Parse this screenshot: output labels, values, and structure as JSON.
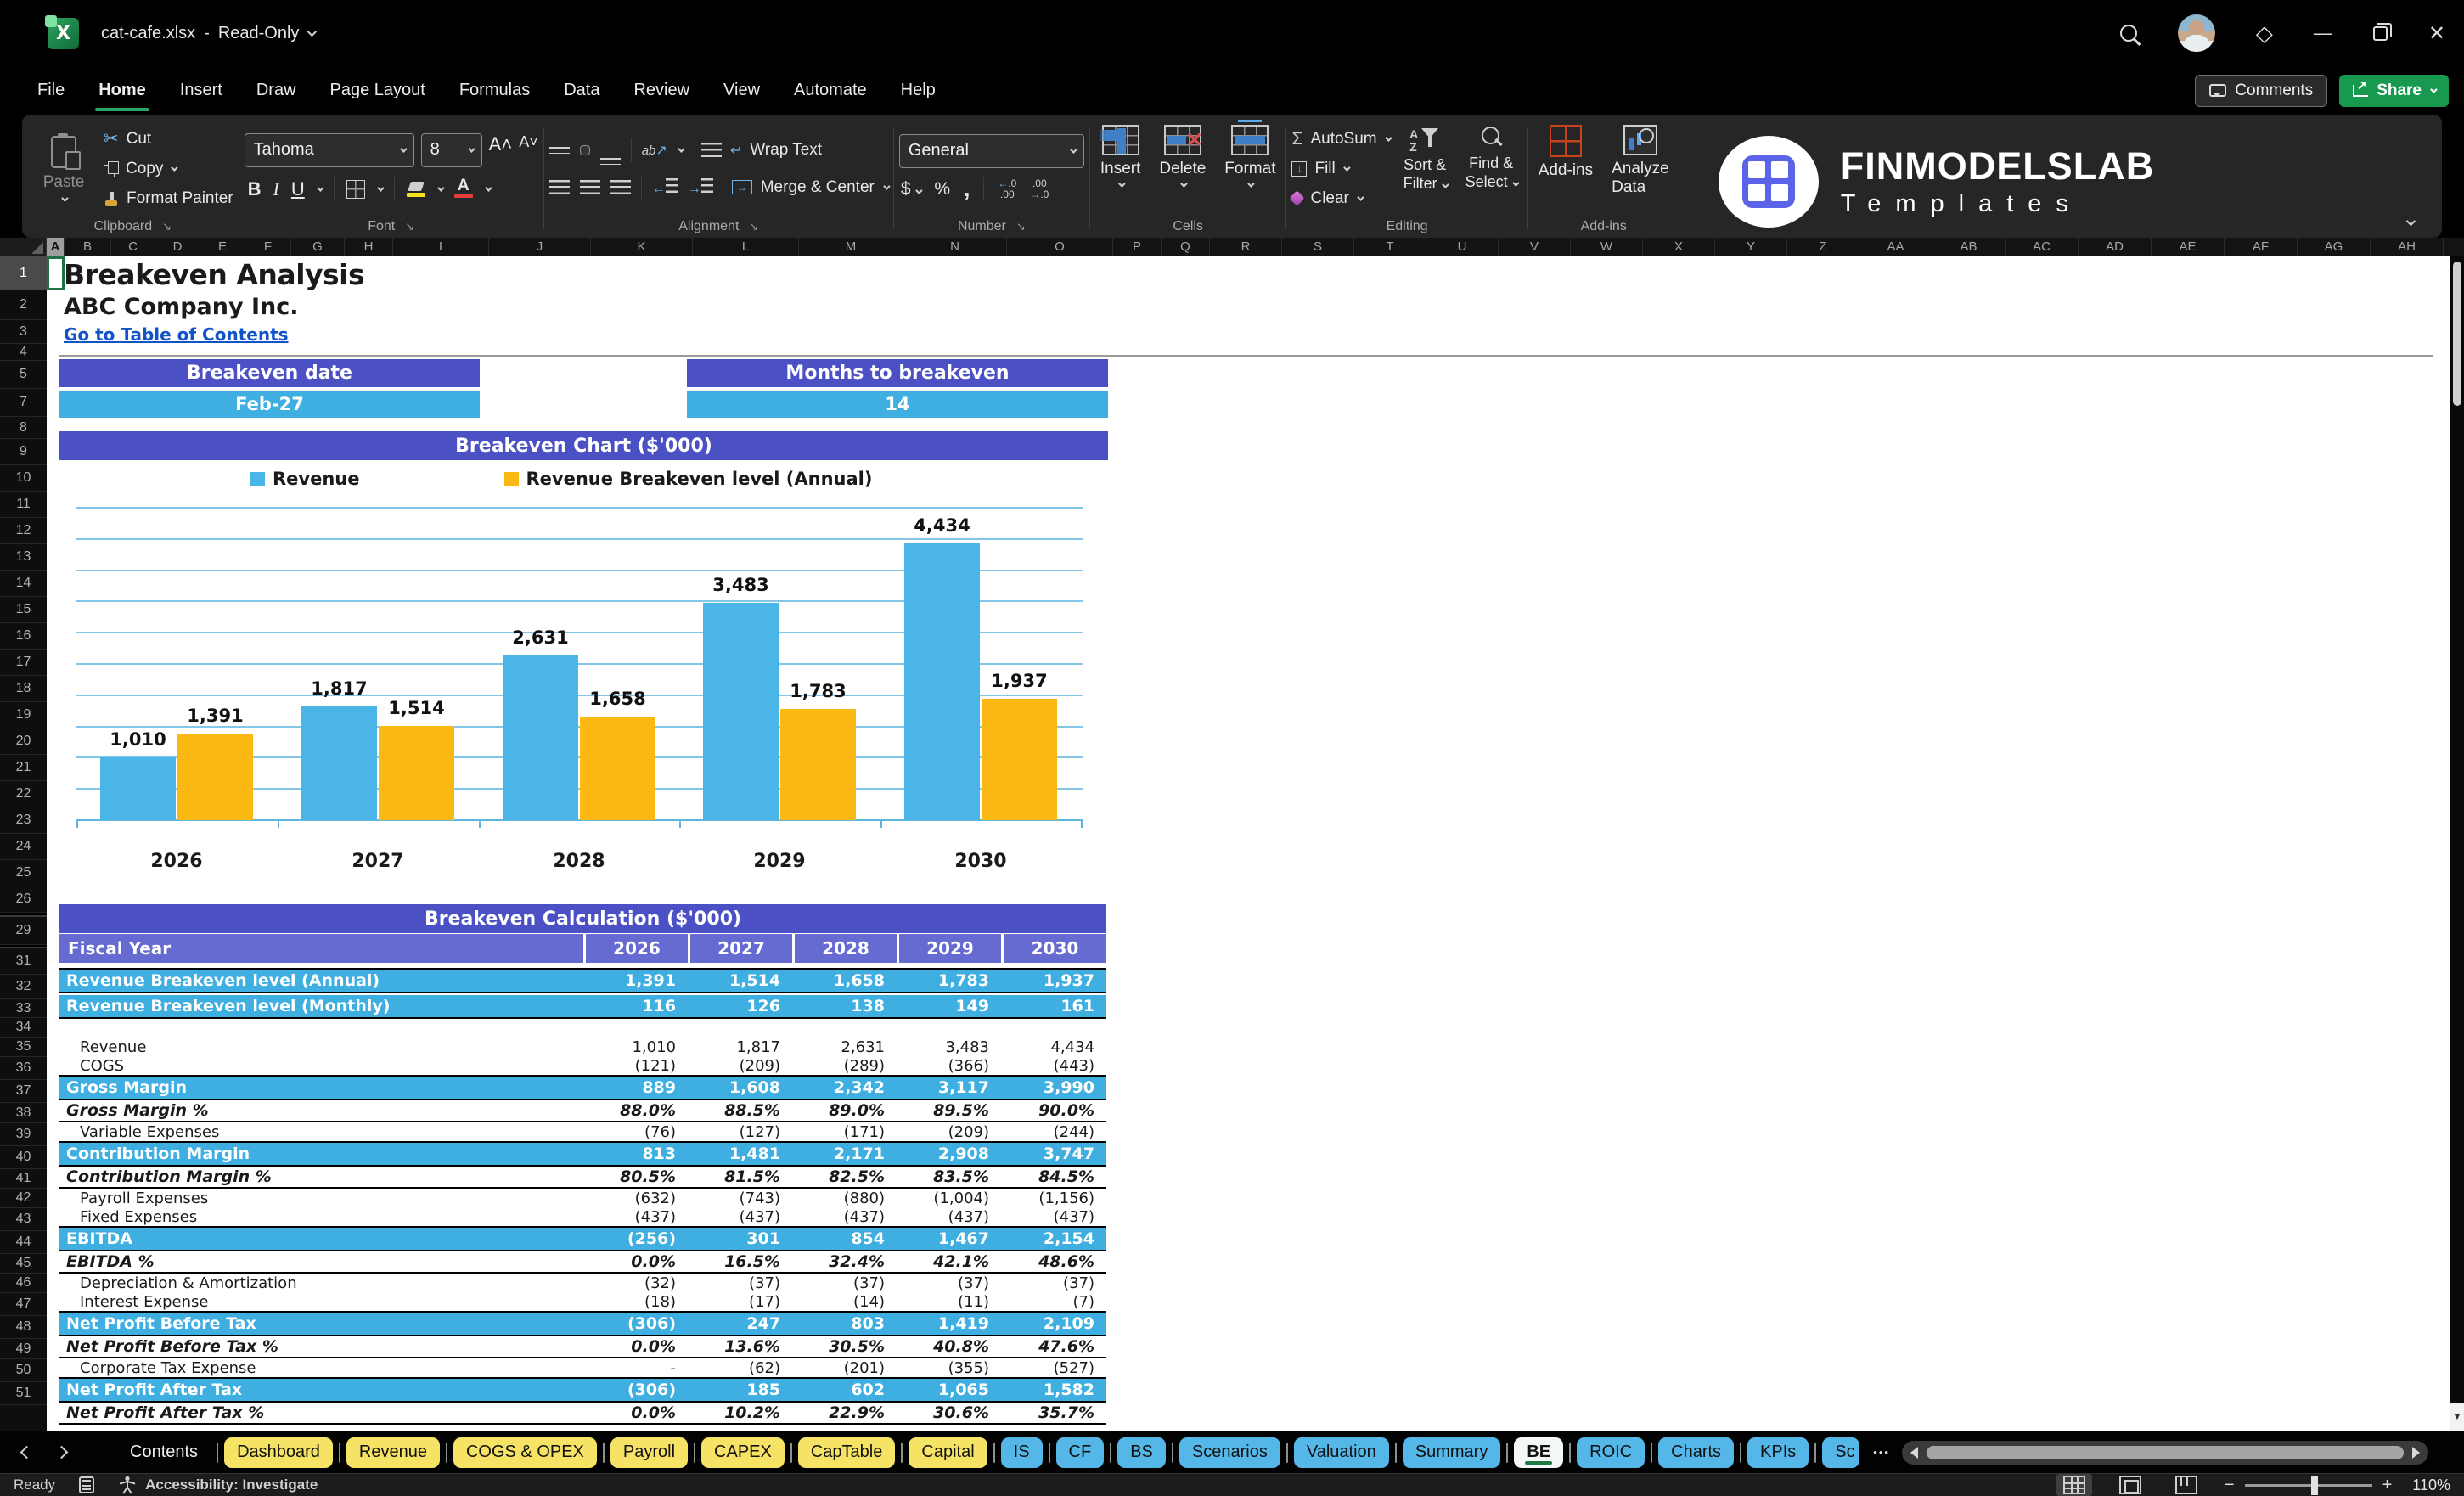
{
  "window": {
    "file_name": "cat-cafe.xlsx",
    "dash": "-",
    "mode": "Read-Only"
  },
  "menu": {
    "tabs": [
      "File",
      "Home",
      "Insert",
      "Draw",
      "Page Layout",
      "Formulas",
      "Data",
      "Review",
      "View",
      "Automate",
      "Help"
    ],
    "active": "Home"
  },
  "actions": {
    "comments": "Comments",
    "share": "Share"
  },
  "ribbon": {
    "clipboard": {
      "paste": "Paste",
      "cut": "Cut",
      "copy": "Copy",
      "format_painter": "Format Painter",
      "label": "Clipboard"
    },
    "font": {
      "family": "Tahoma",
      "size": "8",
      "bold": "B",
      "italic": "I",
      "underline": "U",
      "label": "Font"
    },
    "alignment": {
      "orientation_glyph": "ab",
      "wrap": "Wrap Text",
      "merge": "Merge & Center",
      "label": "Alignment"
    },
    "number": {
      "format": "General",
      "dollar": "$",
      "percent": "%",
      "comma": ",",
      "label": "Number"
    },
    "cells": {
      "insert": "Insert",
      "del": "Delete",
      "format": "Format",
      "label": "Cells"
    },
    "editing": {
      "autosum": "AutoSum",
      "fill": "Fill",
      "clear": "Clear",
      "sort1": "Sort &",
      "sort2": "Filter",
      "find1": "Find &",
      "find2": "Select",
      "label": "Editing"
    },
    "addins": {
      "addins": "Add-ins",
      "analyze1": "Analyze",
      "analyze2": "Data",
      "label": "Add-ins"
    },
    "brand": {
      "name": "FINMODELSLAB",
      "sub": "Templates"
    }
  },
  "sheet": {
    "selected_cell": "A1",
    "columns": [
      {
        "l": "A",
        "w": 21,
        "selected": true
      },
      {
        "l": "B",
        "w": 55
      },
      {
        "l": "C",
        "w": 52
      },
      {
        "l": "D",
        "w": 53
      },
      {
        "l": "E",
        "w": 53
      },
      {
        "l": "F",
        "w": 54
      },
      {
        "l": "G",
        "w": 63
      },
      {
        "l": "H",
        "w": 57
      },
      {
        "l": "I",
        "w": 113
      },
      {
        "l": "J",
        "w": 120
      },
      {
        "l": "K",
        "w": 120
      },
      {
        "l": "L",
        "w": 125
      },
      {
        "l": "M",
        "w": 123
      },
      {
        "l": "N",
        "w": 122
      },
      {
        "l": "O",
        "w": 125
      },
      {
        "l": "P",
        "w": 57
      },
      {
        "l": "Q",
        "w": 57
      },
      {
        "l": "R",
        "w": 85
      },
      {
        "l": "S",
        "w": 85
      },
      {
        "l": "T",
        "w": 85
      },
      {
        "l": "U",
        "w": 85
      },
      {
        "l": "V",
        "w": 85
      },
      {
        "l": "W",
        "w": 85
      },
      {
        "l": "X",
        "w": 85
      },
      {
        "l": "Y",
        "w": 85
      },
      {
        "l": "Z",
        "w": 85
      },
      {
        "l": "AA",
        "w": 86
      },
      {
        "l": "AB",
        "w": 86
      },
      {
        "l": "AC",
        "w": 86
      },
      {
        "l": "AD",
        "w": 86
      },
      {
        "l": "AE",
        "w": 86
      },
      {
        "l": "AF",
        "w": 86
      },
      {
        "l": "AG",
        "w": 86
      },
      {
        "l": "AH",
        "w": 86
      }
    ],
    "rows": [
      {
        "n": "1",
        "h": 40
      },
      {
        "n": "2",
        "h": 35
      },
      {
        "n": "3",
        "h": 28
      },
      {
        "n": "4",
        "h": 20
      },
      {
        "n": "5",
        "h": 33
      },
      {
        "n": "7",
        "h": 33
      },
      {
        "n": "8",
        "h": 26
      },
      {
        "n": "9",
        "h": 31
      },
      {
        "n": "10",
        "h": 31
      },
      {
        "n": "11",
        "h": 31
      },
      {
        "n": "12",
        "h": 31
      },
      {
        "n": "13",
        "h": 31
      },
      {
        "n": "14",
        "h": 31
      },
      {
        "n": "15",
        "h": 31
      },
      {
        "n": "16",
        "h": 31
      },
      {
        "n": "17",
        "h": 31
      },
      {
        "n": "18",
        "h": 31
      },
      {
        "n": "19",
        "h": 31
      },
      {
        "n": "20",
        "h": 31
      },
      {
        "n": "21",
        "h": 31
      },
      {
        "n": "22",
        "h": 31
      },
      {
        "n": "23",
        "h": 31
      },
      {
        "n": "24",
        "h": 31
      },
      {
        "n": "25",
        "h": 31
      },
      {
        "n": "26",
        "h": 31
      },
      {
        "n": "",
        "h": 5
      },
      {
        "n": "29",
        "h": 33
      },
      {
        "n": "",
        "h": 4
      },
      {
        "n": "31",
        "h": 31
      },
      {
        "n": "32",
        "h": 29
      },
      {
        "n": "33",
        "h": 22
      },
      {
        "n": "34",
        "h": 23
      },
      {
        "n": "35",
        "h": 23
      },
      {
        "n": "36",
        "h": 27
      },
      {
        "n": "37",
        "h": 27
      },
      {
        "n": "38",
        "h": 24
      },
      {
        "n": "39",
        "h": 27
      },
      {
        "n": "40",
        "h": 27
      },
      {
        "n": "41",
        "h": 23
      },
      {
        "n": "42",
        "h": 23
      },
      {
        "n": "43",
        "h": 27
      },
      {
        "n": "44",
        "h": 27
      },
      {
        "n": "45",
        "h": 23
      },
      {
        "n": "46",
        "h": 23
      },
      {
        "n": "47",
        "h": 27
      },
      {
        "n": "48",
        "h": 27
      },
      {
        "n": "49",
        "h": 24
      },
      {
        "n": "50",
        "h": 27
      },
      {
        "n": "51",
        "h": 27
      }
    ]
  },
  "content": {
    "title": "Breakeven Analysis",
    "company": "ABC Company Inc.",
    "link": "Go to Table of Contents",
    "date_header": "Breakeven date",
    "date_value": "Feb-27",
    "months_header": "Months to breakeven",
    "months_value": "14",
    "chart_banner": "Breakeven Chart ($'000)",
    "calc_banner": "Breakeven Calculation ($'000)"
  },
  "chart_data": {
    "type": "bar",
    "title": "Breakeven Chart ($'000)",
    "categories": [
      "2026",
      "2027",
      "2028",
      "2029",
      "2030"
    ],
    "series": [
      {
        "name": "Revenue",
        "color": "#4ab5e6",
        "values": [
          1010,
          1817,
          2631,
          3483,
          4434
        ]
      },
      {
        "name": "Revenue Breakeven level (Annual)",
        "color": "#fcb813",
        "values": [
          1391,
          1514,
          1658,
          1783,
          1937
        ]
      }
    ],
    "ylim": [
      0,
      5000
    ],
    "gridline_step": 500,
    "grid": true,
    "legend_position": "top",
    "data_labels": true
  },
  "calc": {
    "fiscal_label": "Fiscal Year",
    "years": [
      "2026",
      "2027",
      "2028",
      "2029",
      "2030"
    ],
    "rows": [
      {
        "label": "Revenue Breakeven level (Annual)",
        "style": "blue",
        "values": [
          "1,391",
          "1,514",
          "1,658",
          "1,783",
          "1,937"
        ]
      },
      {
        "label": "Revenue Breakeven level (Monthly)",
        "style": "blue",
        "values": [
          "116",
          "126",
          "138",
          "149",
          "161"
        ]
      },
      {
        "style": "gap"
      },
      {
        "label": "Revenue",
        "style": "plain",
        "values": [
          "1,010",
          "1,817",
          "2,631",
          "3,483",
          "4,434"
        ]
      },
      {
        "label": "COGS",
        "style": "plain",
        "values": [
          "(121)",
          "(209)",
          "(289)",
          "(366)",
          "(443)"
        ]
      },
      {
        "label": "Gross Margin",
        "style": "blue",
        "values": [
          "889",
          "1,608",
          "2,342",
          "3,117",
          "3,990"
        ]
      },
      {
        "label": "Gross Margin %",
        "style": "pct",
        "values": [
          "88.0%",
          "88.5%",
          "89.0%",
          "89.5%",
          "90.0%"
        ]
      },
      {
        "label": "Variable Expenses",
        "style": "plain",
        "values": [
          "(76)",
          "(127)",
          "(171)",
          "(209)",
          "(244)"
        ]
      },
      {
        "label": "Contribution Margin",
        "style": "blue",
        "values": [
          "813",
          "1,481",
          "2,171",
          "2,908",
          "3,747"
        ]
      },
      {
        "label": "Contribution Margin %",
        "style": "pct",
        "values": [
          "80.5%",
          "81.5%",
          "82.5%",
          "83.5%",
          "84.5%"
        ]
      },
      {
        "label": "Payroll Expenses",
        "style": "plain",
        "values": [
          "(632)",
          "(743)",
          "(880)",
          "(1,004)",
          "(1,156)"
        ]
      },
      {
        "label": "Fixed Expenses",
        "style": "plain",
        "values": [
          "(437)",
          "(437)",
          "(437)",
          "(437)",
          "(437)"
        ]
      },
      {
        "label": "EBITDA",
        "style": "blue",
        "values": [
          "(256)",
          "301",
          "854",
          "1,467",
          "2,154"
        ]
      },
      {
        "label": "EBITDA %",
        "style": "pct",
        "values": [
          "0.0%",
          "16.5%",
          "32.4%",
          "42.1%",
          "48.6%"
        ]
      },
      {
        "label": "Depreciation & Amortization",
        "style": "plain",
        "values": [
          "(32)",
          "(37)",
          "(37)",
          "(37)",
          "(37)"
        ]
      },
      {
        "label": "Interest Expense",
        "style": "plain",
        "values": [
          "(18)",
          "(17)",
          "(14)",
          "(11)",
          "(7)"
        ]
      },
      {
        "label": "Net Profit Before Tax",
        "style": "blue",
        "values": [
          "(306)",
          "247",
          "803",
          "1,419",
          "2,109"
        ]
      },
      {
        "label": "Net Profit Before Tax %",
        "style": "pct",
        "values": [
          "0.0%",
          "13.6%",
          "30.5%",
          "40.8%",
          "47.6%"
        ]
      },
      {
        "label": "Corporate Tax Expense",
        "style": "plain",
        "values": [
          "-",
          "(62)",
          "(201)",
          "(355)",
          "(527)"
        ]
      },
      {
        "label": "Net Profit After Tax",
        "style": "blue",
        "values": [
          "(306)",
          "185",
          "602",
          "1,065",
          "1,582"
        ]
      },
      {
        "label": "Net Profit After Tax %",
        "style": "pct",
        "values": [
          "0.0%",
          "10.2%",
          "22.9%",
          "30.6%",
          "35.7%"
        ]
      }
    ]
  },
  "sheet_tabs": [
    {
      "label": "Contents",
      "style": "plain"
    },
    {
      "label": "Dashboard",
      "style": "yellow"
    },
    {
      "label": "Revenue",
      "style": "yellow"
    },
    {
      "label": "COGS & OPEX",
      "style": "yellow"
    },
    {
      "label": "Payroll",
      "style": "yellow"
    },
    {
      "label": "CAPEX",
      "style": "yellow"
    },
    {
      "label": "CapTable",
      "style": "yellow"
    },
    {
      "label": "Capital",
      "style": "yellow"
    },
    {
      "label": "IS",
      "style": "blue"
    },
    {
      "label": "CF",
      "style": "blue"
    },
    {
      "label": "BS",
      "style": "blue"
    },
    {
      "label": "Scenarios",
      "style": "blue"
    },
    {
      "label": "Valuation",
      "style": "blue"
    },
    {
      "label": "Summary",
      "style": "blue"
    },
    {
      "label": "BE",
      "style": "active"
    },
    {
      "label": "ROIC",
      "style": "blue"
    },
    {
      "label": "Charts",
      "style": "blue"
    },
    {
      "label": "KPIs",
      "style": "blue"
    },
    {
      "label": "Sc",
      "style": "blue-trunc"
    }
  ],
  "status": {
    "ready": "Ready",
    "accessibility": "Accessibility: Investigate",
    "zoom_level": "110%"
  },
  "colors": {
    "banner_purple": "#4b51c5",
    "fiscal_purple": "#666bd1",
    "row_blue": "#3fafe2",
    "bar_blue": "#4ab5e6",
    "bar_yellow": "#fcb813",
    "tab_yellow": "#f6e264",
    "tab_blue": "#55b6e8",
    "accent_green": "#2aa567",
    "link_blue": "#1353c9"
  }
}
